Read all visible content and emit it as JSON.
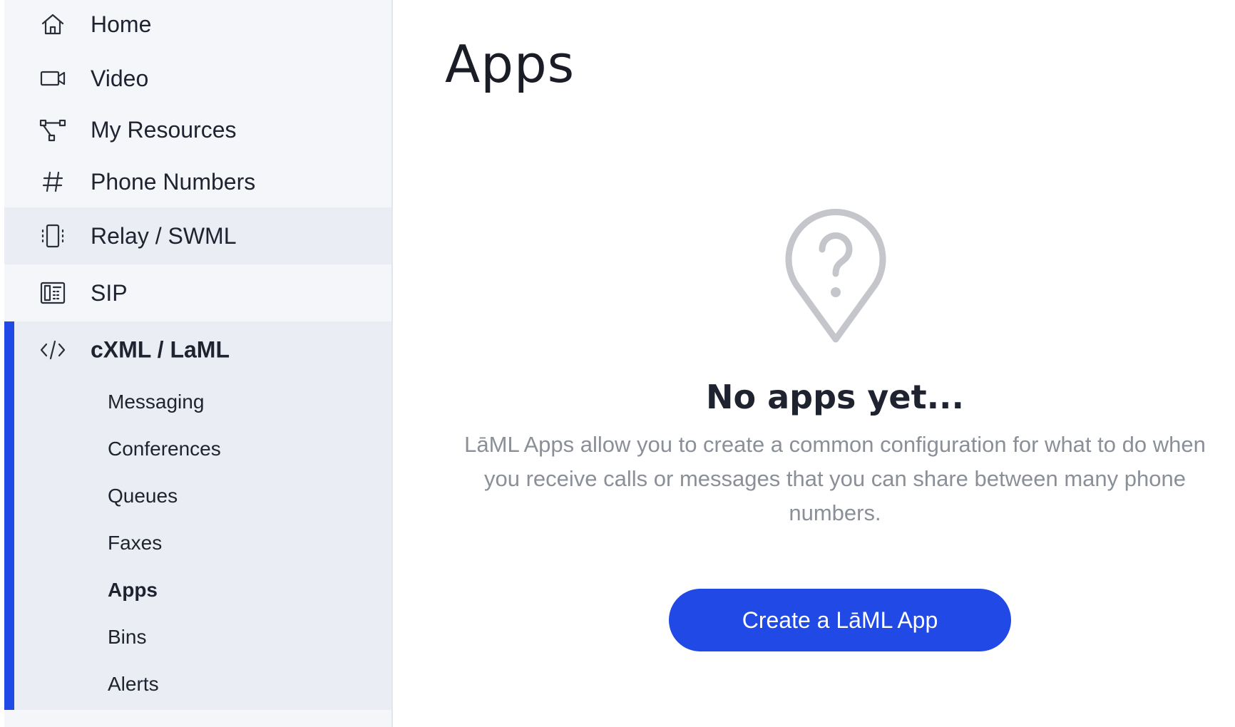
{
  "sidebar": {
    "items": [
      {
        "label": "Home",
        "icon": "home-icon"
      },
      {
        "label": "Video",
        "icon": "video-icon"
      },
      {
        "label": "My Resources",
        "icon": "resources-icon"
      },
      {
        "label": "Phone Numbers",
        "icon": "hash-icon"
      },
      {
        "label": "Relay / SWML",
        "icon": "relay-icon"
      },
      {
        "label": "SIP",
        "icon": "sip-icon"
      }
    ],
    "group": {
      "label": "cXML / LaML",
      "icon": "code-icon",
      "sub_items": [
        {
          "label": "Messaging"
        },
        {
          "label": "Conferences"
        },
        {
          "label": "Queues"
        },
        {
          "label": "Faxes"
        },
        {
          "label": "Apps",
          "active": true
        },
        {
          "label": "Bins"
        },
        {
          "label": "Alerts"
        }
      ]
    }
  },
  "main": {
    "title": "Apps",
    "empty_state": {
      "icon": "question-pin-icon",
      "title": "No apps yet...",
      "description": "LāML Apps allow you to create a common configuration for what to do when you receive calls or messages that you can share between many phone numbers.",
      "button_label": "Create a LāML App"
    }
  },
  "colors": {
    "accent": "#2049e6",
    "sidebar_bg": "#f4f6fa",
    "group_bg": "#eaedf3",
    "muted_text": "#8a8f98",
    "icon_gray": "#c4c6cb"
  }
}
